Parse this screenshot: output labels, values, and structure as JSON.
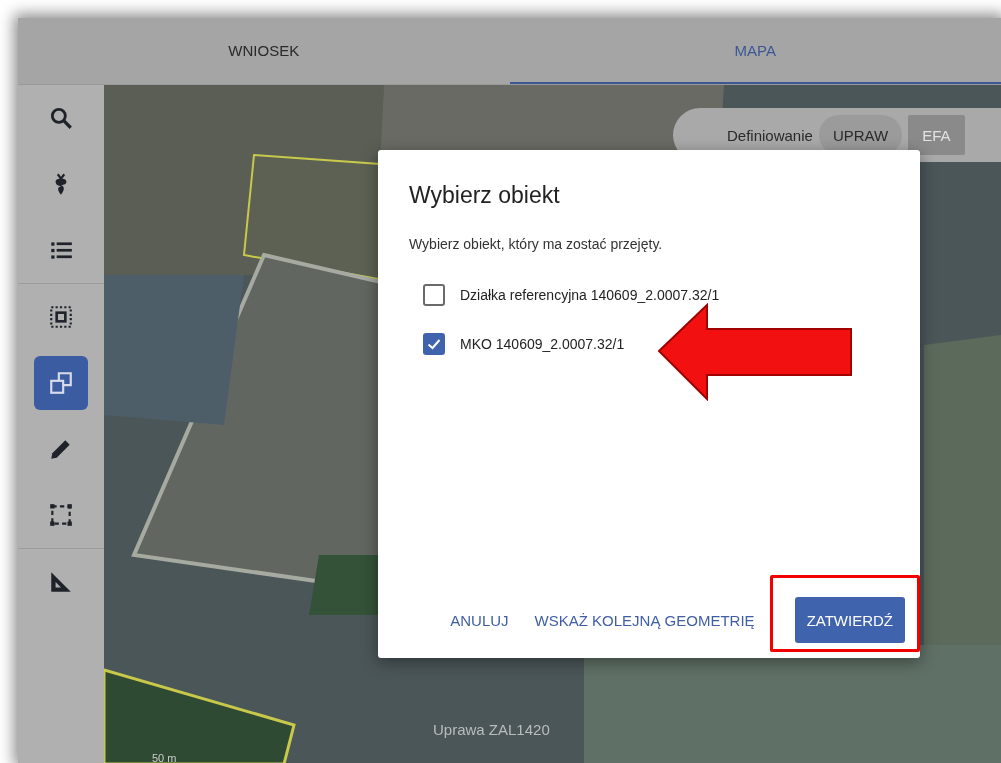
{
  "tabs": [
    {
      "label": "WNIOSEK",
      "selected": false
    },
    {
      "label": "MAPA",
      "selected": true
    }
  ],
  "tool_groups": [
    {
      "tools": [
        {
          "kind": "search",
          "selected": false
        },
        {
          "kind": "crop",
          "selected": false
        },
        {
          "kind": "list",
          "selected": false
        }
      ]
    },
    {
      "tools": [
        {
          "kind": "select",
          "selected": false
        },
        {
          "kind": "copy",
          "selected": true
        },
        {
          "kind": "pencil",
          "selected": false
        },
        {
          "kind": "frame",
          "selected": false
        }
      ]
    },
    {
      "tools": [
        {
          "kind": "ruler",
          "selected": false
        }
      ]
    }
  ],
  "map_mode": {
    "label": "Definiowanie",
    "options": [
      {
        "label": "UPRAW",
        "selected": true,
        "disabled": false
      },
      {
        "label": "EFA",
        "selected": false,
        "disabled": true
      }
    ]
  },
  "map": {
    "labels": [
      "Uprawa ZAL1420"
    ],
    "scale": "50 m"
  },
  "dialog": {
    "title": "Wybierz obiekt",
    "message": "Wybierz obiekt, który ma zostać przejęty.",
    "options": [
      {
        "label": "Działka referencyjna 140609_2.0007.32/1",
        "checked": false
      },
      {
        "label": "MKO 140609_2.0007.32/1",
        "checked": true
      }
    ],
    "buttons": [
      {
        "label": "ANULUJ",
        "kind": "text"
      },
      {
        "label": "WSKAŻ KOLEJNĄ GEOMETRIĘ",
        "kind": "text"
      },
      {
        "label": "ZATWIERDŹ",
        "kind": "primary"
      }
    ]
  }
}
